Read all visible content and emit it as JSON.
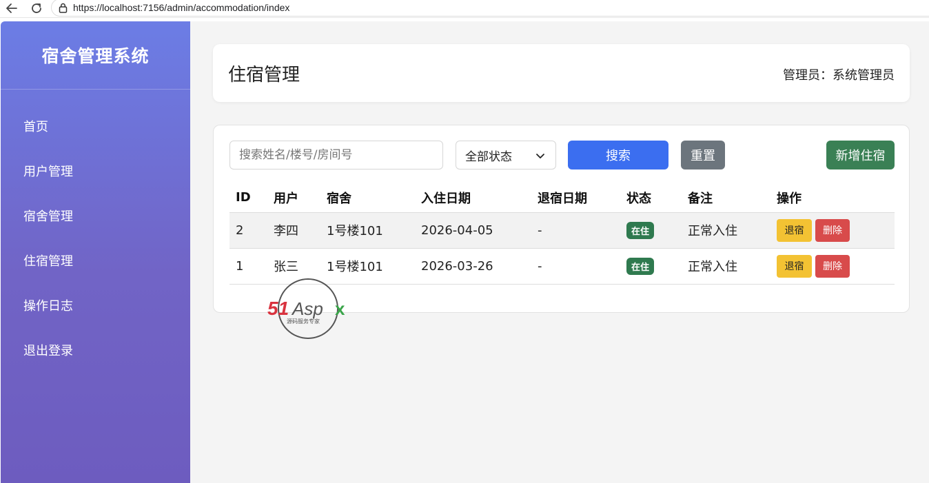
{
  "browser": {
    "url": "https://localhost:7156/admin/accommodation/index"
  },
  "sidebar": {
    "brand": "宿舍管理系统",
    "items": [
      {
        "label": "首页"
      },
      {
        "label": "用户管理"
      },
      {
        "label": "宿舍管理"
      },
      {
        "label": "住宿管理"
      },
      {
        "label": "操作日志"
      },
      {
        "label": "退出登录"
      }
    ]
  },
  "header": {
    "title": "住宿管理",
    "admin": "管理员：系统管理员"
  },
  "toolbar": {
    "search_placeholder": "搜索姓名/楼号/房间号",
    "status_selected": "全部状态",
    "search_label": "搜索",
    "reset_label": "重置",
    "add_label": "新增住宿"
  },
  "table": {
    "columns": [
      "ID",
      "用户",
      "宿舍",
      "入住日期",
      "退宿日期",
      "状态",
      "备注",
      "操作"
    ],
    "rows": [
      {
        "id": "2",
        "user": "李四",
        "dorm": "1号楼101",
        "checkin": "2026-04-05",
        "checkout": "-",
        "status": "在住",
        "note": "正常入住",
        "action_checkout": "退宿",
        "action_delete": "删除"
      },
      {
        "id": "1",
        "user": "张三",
        "dorm": "1号楼101",
        "checkin": "2026-03-26",
        "checkout": "-",
        "status": "在住",
        "note": "正常入住",
        "action_checkout": "退宿",
        "action_delete": "删除"
      }
    ]
  },
  "watermark": {
    "logo_text": "51Aspx",
    "tagline": "源码服务专家"
  },
  "colors": {
    "primary": "#3b6ef0",
    "success": "#3a8055",
    "secondary": "#6c757d",
    "warning": "#f3c233",
    "danger": "#d84b4b",
    "sidebar_top": "#6c7de5",
    "sidebar_bottom": "#6d5cbf"
  }
}
